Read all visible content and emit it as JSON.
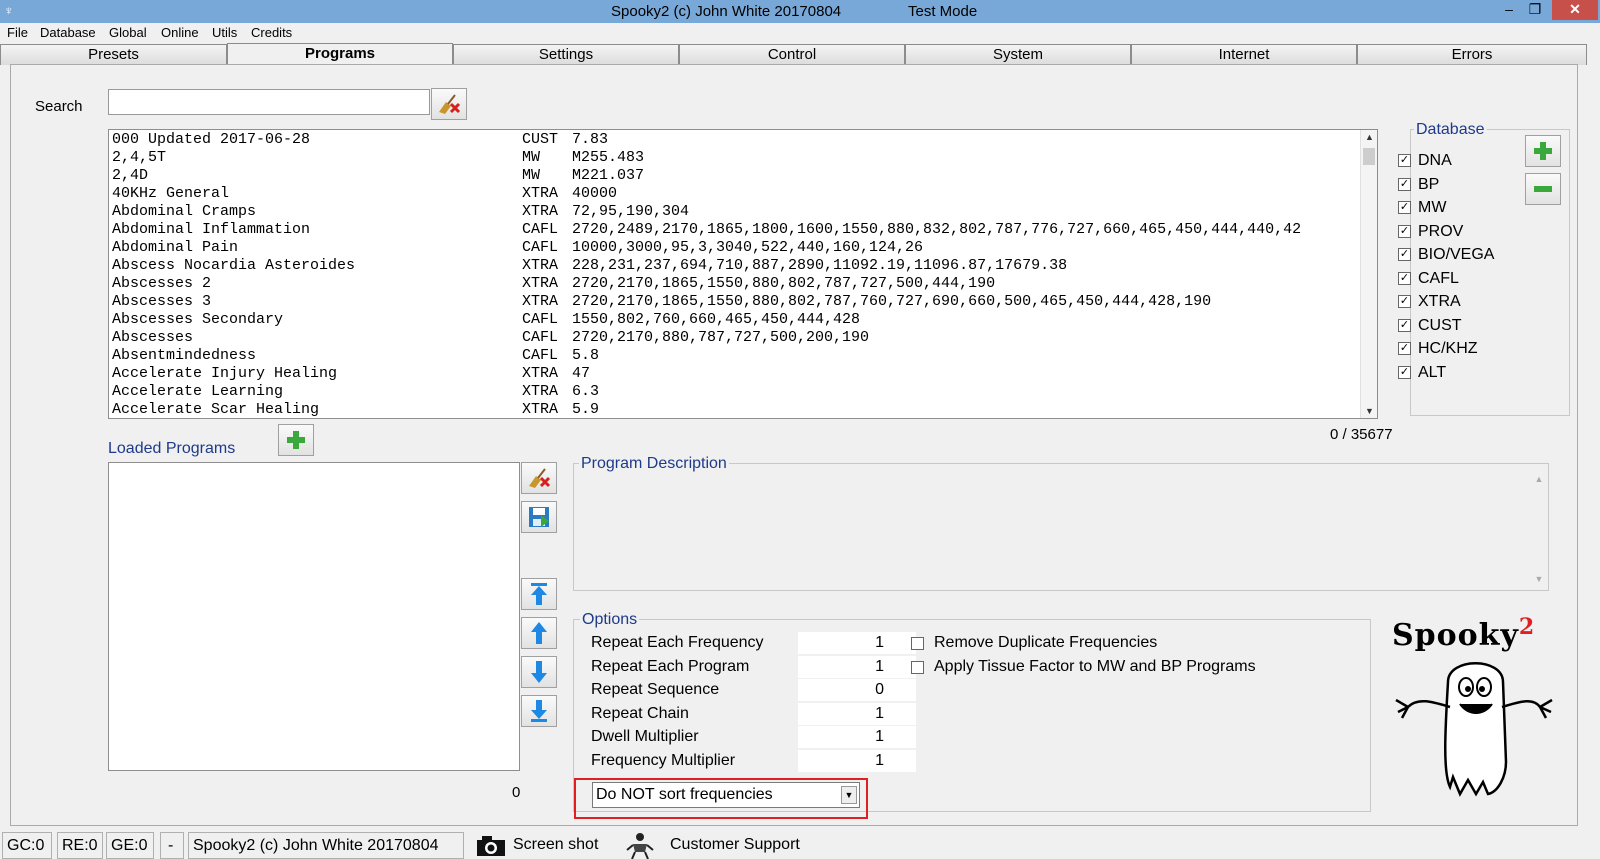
{
  "titlebar": {
    "title": "Spooky2 (c) John White 20170804",
    "mode": "Test Mode",
    "minimize": "–",
    "maximize": "❐",
    "close": "✕"
  },
  "menu": [
    "File",
    "Database",
    "Global",
    "Online",
    "Utils",
    "Credits"
  ],
  "tabs": [
    "Presets",
    "Programs",
    "Settings",
    "Control",
    "System",
    "Internet",
    "Errors"
  ],
  "search": {
    "label": "Search",
    "value": ""
  },
  "programs": [
    [
      "000 Updated 2017-06-28",
      "CUST",
      "7.83"
    ],
    [
      "2,4,5T",
      "MW",
      "M255.483"
    ],
    [
      "2,4D",
      "MW",
      "M221.037"
    ],
    [
      "40KHz General",
      "XTRA",
      "40000"
    ],
    [
      "Abdominal Cramps",
      "XTRA",
      "72,95,190,304"
    ],
    [
      "Abdominal Inflammation",
      "CAFL",
      "2720,2489,2170,1865,1800,1600,1550,880,832,802,787,776,727,660,465,450,444,440,42"
    ],
    [
      "Abdominal Pain",
      "CAFL",
      "10000,3000,95,3,3040,522,440,160,124,26"
    ],
    [
      "Abscess Nocardia Asteroides",
      "XTRA",
      "228,231,237,694,710,887,2890,11092.19,11096.87,17679.38"
    ],
    [
      "Abscesses 2",
      "XTRA",
      "2720,2170,1865,1550,880,802,787,727,500,444,190"
    ],
    [
      "Abscesses 3",
      "XTRA",
      "2720,2170,1865,1550,880,802,787,760,727,690,660,500,465,450,444,428,190"
    ],
    [
      "Abscesses Secondary",
      "CAFL",
      "1550,802,760,660,465,450,444,428"
    ],
    [
      "Abscesses",
      "CAFL",
      "2720,2170,880,787,727,500,200,190"
    ],
    [
      "Absentmindedness",
      "CAFL",
      "5.8"
    ],
    [
      "Accelerate Injury Healing",
      "XTRA",
      "47"
    ],
    [
      "Accelerate Learning",
      "XTRA",
      "6.3"
    ],
    [
      "Accelerate Scar Healing",
      "XTRA",
      "5.9"
    ]
  ],
  "count": "0 / 35677",
  "database": {
    "title": "Database",
    "items": [
      "DNA",
      "BP",
      "MW",
      "PROV",
      "BIO/VEGA",
      "CAFL",
      "XTRA",
      "CUST",
      "HC/KHZ",
      "ALT"
    ],
    "checkmark": "✓"
  },
  "loaded": {
    "title": "Loaded Programs",
    "count": "0"
  },
  "description": {
    "title": "Program Description"
  },
  "options": {
    "title": "Options",
    "rows": [
      {
        "label": "Repeat Each Frequency",
        "value": "1"
      },
      {
        "label": "Repeat Each Program",
        "value": "1"
      },
      {
        "label": "Repeat Sequence",
        "value": "0"
      },
      {
        "label": "Repeat Chain",
        "value": "1"
      },
      {
        "label": "Dwell Multiplier",
        "value": "1"
      },
      {
        "label": "Frequency Multiplier",
        "value": "1"
      }
    ],
    "checks": [
      "Remove Duplicate Frequencies",
      "Apply Tissue Factor to MW and BP Programs"
    ],
    "sort": "Do NOT sort frequencies"
  },
  "logo": {
    "text": "Spooky",
    "sup": "2"
  },
  "status": {
    "gc": "GC:0",
    "re": "RE:0",
    "ge": "GE:0",
    "dash": "-",
    "app": "Spooky2 (c) John White 20170804",
    "screenshot": "Screen shot",
    "support": "Customer Support"
  },
  "colors": {
    "accent": "#1e3a8a",
    "titlebar": "#78a8d8",
    "highlight": "#e02020"
  }
}
